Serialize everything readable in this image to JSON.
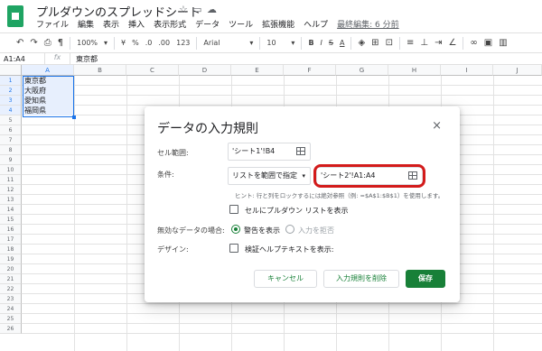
{
  "titlebar": {
    "doc_title": "プルダウンのスプレッドシート",
    "star_icon": "star-icon",
    "folder_icon": "folder-icon",
    "cloud_icon": "cloud-icon",
    "menus": [
      "ファイル",
      "編集",
      "表示",
      "挿入",
      "表示形式",
      "データ",
      "ツール",
      "拡張機能",
      "ヘルプ"
    ],
    "last_edit": "最終編集: 6 分前"
  },
  "toolbar": {
    "zoom": "100%",
    "currency": "¥",
    "percent": "%",
    "decimal_less": ".0",
    "decimal_more": ".00",
    "number_format": "123",
    "font": "Arial",
    "font_size": "10",
    "bold": "B",
    "italic": "I",
    "strike": "S",
    "text_color": "A"
  },
  "formula_bar": {
    "name_box": "A1:A4",
    "fx": "fx",
    "value": "東京都"
  },
  "grid": {
    "columns": [
      "A",
      "B",
      "C",
      "D",
      "E",
      "F",
      "G",
      "H",
      "I",
      "J"
    ],
    "rows": [
      "1",
      "2",
      "3",
      "4",
      "5",
      "6",
      "7",
      "8",
      "9",
      "10",
      "11",
      "12",
      "13",
      "14",
      "15",
      "16",
      "17",
      "18",
      "19",
      "20",
      "21",
      "22",
      "23",
      "24",
      "25",
      "26"
    ],
    "cells": [
      "東京都",
      "大阪府",
      "愛知県",
      "福岡県"
    ]
  },
  "dialog": {
    "title": "データの入力規則",
    "close": "×",
    "range_label": "セル範囲:",
    "range_value": "'シート1'!B4",
    "criteria_label": "条件:",
    "criteria_type": "リストを範囲で指定",
    "criteria_range": "'シート2'!A1:A4",
    "hint": "ヒント: 行と列をロックするには絶対参照（例: =$A$1:$B$1）を使用します。",
    "show_dropdown": "セルにプルダウン リストを表示",
    "invalid_label": "無効なデータの場合:",
    "option_warning": "警告を表示",
    "option_reject": "入力を拒否",
    "appearance_label": "デザイン:",
    "help_text": "検証ヘルプテキストを表示:",
    "cancel": "キャンセル",
    "remove": "入力規則を削除",
    "save": "保存"
  },
  "colors": {
    "accent_green": "#188038",
    "selection_blue": "#1a73e8",
    "highlight_red": "#d31b1b"
  }
}
